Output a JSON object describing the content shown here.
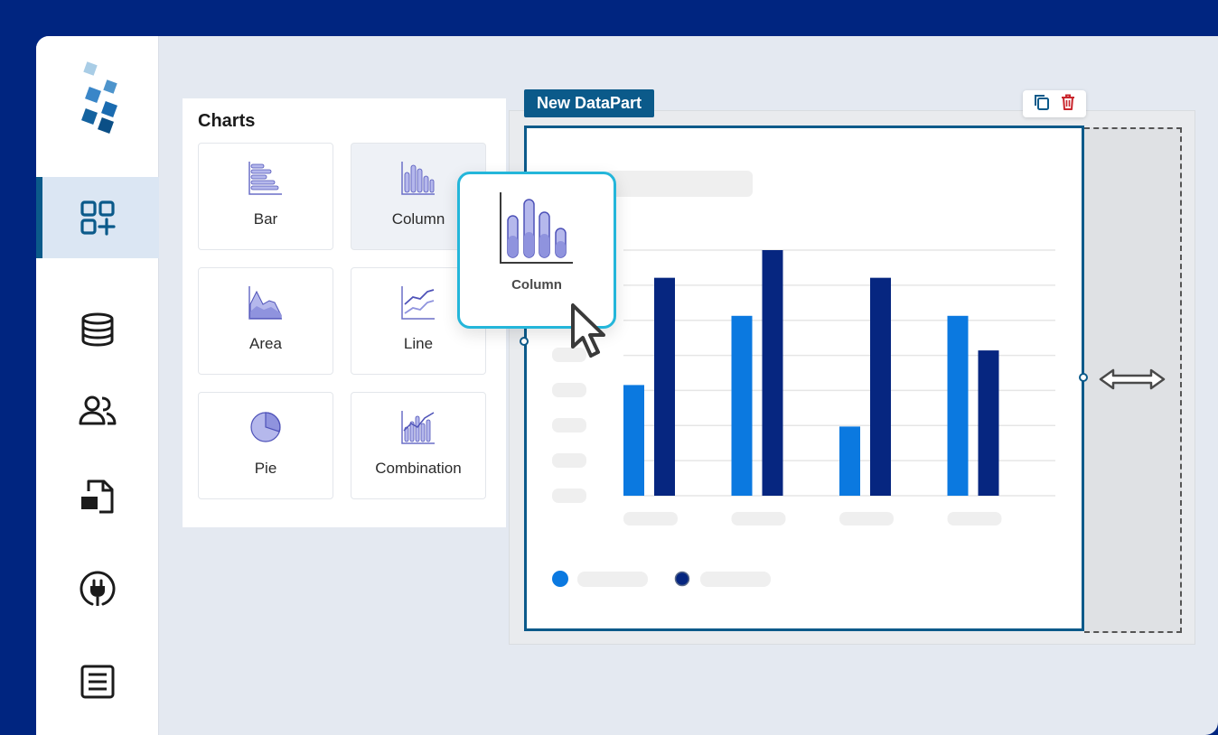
{
  "charts_panel": {
    "title": "Charts",
    "items": [
      {
        "label": "Bar",
        "icon": "bar-chart-icon"
      },
      {
        "label": "Column",
        "icon": "column-chart-icon"
      },
      {
        "label": "Area",
        "icon": "area-chart-icon"
      },
      {
        "label": "Line",
        "icon": "line-chart-icon"
      },
      {
        "label": "Pie",
        "icon": "pie-chart-icon"
      },
      {
        "label": "Combination",
        "icon": "combination-chart-icon"
      }
    ]
  },
  "drag_preview": {
    "label": "Column",
    "icon": "column-chart-icon"
  },
  "datapart": {
    "title": "New DataPart",
    "actions": [
      "copy-icon",
      "trash-icon"
    ]
  },
  "sidebar": {
    "items": [
      {
        "icon": "add-widget-icon",
        "active": true
      },
      {
        "icon": "database-icon"
      },
      {
        "icon": "users-icon"
      },
      {
        "icon": "import-file-icon"
      },
      {
        "icon": "plug-icon"
      },
      {
        "icon": "document-list-icon"
      }
    ]
  },
  "colors": {
    "frame": "#002580",
    "accent": "#0b5a8a",
    "series_light": "#0b79e0",
    "series_dark": "#062680",
    "drag_border": "#24b6da",
    "delete": "#c9252c"
  },
  "chart_data": {
    "type": "bar",
    "categories": [
      "",
      "",
      "",
      ""
    ],
    "series": [
      {
        "values": [
          32,
          52,
          20,
          52
        ]
      },
      {
        "values": [
          63,
          71,
          63,
          42
        ]
      }
    ],
    "ylim": [
      0,
      71
    ],
    "grid": true,
    "legend": "bottom-left"
  }
}
